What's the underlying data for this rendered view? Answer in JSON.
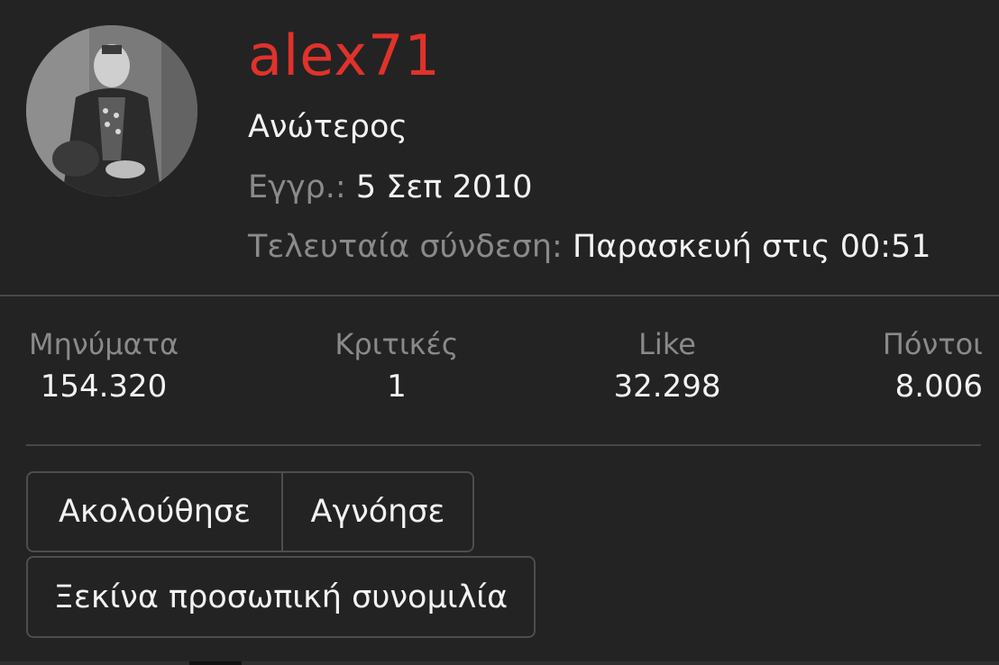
{
  "profile": {
    "username": "alex71",
    "rank": "Ανώτερος",
    "registered_label": "Εγγρ.:",
    "registered_value": "5 Σεπ 2010",
    "last_seen_label": "Τελευταία σύνδεση:",
    "last_seen_value": "Παρασκευή στις 00:51"
  },
  "stats": [
    {
      "label": "Μηνύματα",
      "value": "154.320"
    },
    {
      "label": "Κριτικές",
      "value": "1"
    },
    {
      "label": "Like",
      "value": "32.298"
    },
    {
      "label": "Πόντοι",
      "value": "8.006"
    }
  ],
  "actions": {
    "follow_label": "Ακολούθησε",
    "ignore_label": "Αγνόησε",
    "start_chat_label": "Ξεκίνα προσωπική συνομιλία"
  },
  "colors": {
    "background": "#232323",
    "username": "#e0322b",
    "muted_label": "#8a8a8a",
    "text": "#f2f2f2",
    "border": "#4d4d4d"
  }
}
